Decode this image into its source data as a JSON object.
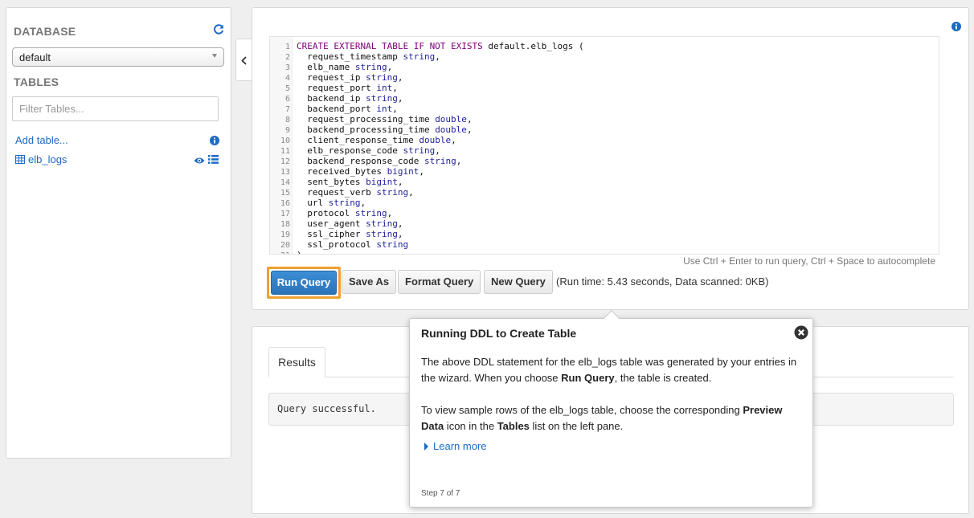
{
  "sidebar": {
    "database_heading": "DATABASE",
    "database_selected": "default",
    "tables_heading": "TABLES",
    "filter_placeholder": "Filter Tables...",
    "add_table": "Add table...",
    "tables": [
      {
        "name": "elb_logs"
      }
    ]
  },
  "editor": {
    "lines": [
      {
        "n": "1",
        "parts": [
          {
            "t": "CREATE EXTERNAL TABLE IF NOT EXISTS",
            "c": "kw"
          },
          {
            "t": " default.elb_logs (",
            "c": ""
          }
        ]
      },
      {
        "n": "2",
        "parts": [
          {
            "t": "  request_timestamp ",
            "c": ""
          },
          {
            "t": "string",
            "c": "ty"
          },
          {
            "t": ",",
            "c": ""
          }
        ]
      },
      {
        "n": "3",
        "parts": [
          {
            "t": "  elb_name ",
            "c": ""
          },
          {
            "t": "string",
            "c": "ty"
          },
          {
            "t": ",",
            "c": ""
          }
        ]
      },
      {
        "n": "4",
        "parts": [
          {
            "t": "  request_ip ",
            "c": ""
          },
          {
            "t": "string",
            "c": "ty"
          },
          {
            "t": ",",
            "c": ""
          }
        ]
      },
      {
        "n": "5",
        "parts": [
          {
            "t": "  request_port ",
            "c": ""
          },
          {
            "t": "int",
            "c": "ty"
          },
          {
            "t": ",",
            "c": ""
          }
        ]
      },
      {
        "n": "6",
        "parts": [
          {
            "t": "  backend_ip ",
            "c": ""
          },
          {
            "t": "string",
            "c": "ty"
          },
          {
            "t": ",",
            "c": ""
          }
        ]
      },
      {
        "n": "7",
        "parts": [
          {
            "t": "  backend_port ",
            "c": ""
          },
          {
            "t": "int",
            "c": "ty"
          },
          {
            "t": ",",
            "c": ""
          }
        ]
      },
      {
        "n": "8",
        "parts": [
          {
            "t": "  request_processing_time ",
            "c": ""
          },
          {
            "t": "double",
            "c": "ty"
          },
          {
            "t": ",",
            "c": ""
          }
        ]
      },
      {
        "n": "9",
        "parts": [
          {
            "t": "  backend_processing_time ",
            "c": ""
          },
          {
            "t": "double",
            "c": "ty"
          },
          {
            "t": ",",
            "c": ""
          }
        ]
      },
      {
        "n": "10",
        "parts": [
          {
            "t": "  client_response_time ",
            "c": ""
          },
          {
            "t": "double",
            "c": "ty"
          },
          {
            "t": ",",
            "c": ""
          }
        ]
      },
      {
        "n": "11",
        "parts": [
          {
            "t": "  elb_response_code ",
            "c": ""
          },
          {
            "t": "string",
            "c": "ty"
          },
          {
            "t": ",",
            "c": ""
          }
        ]
      },
      {
        "n": "12",
        "parts": [
          {
            "t": "  backend_response_code ",
            "c": ""
          },
          {
            "t": "string",
            "c": "ty"
          },
          {
            "t": ",",
            "c": ""
          }
        ]
      },
      {
        "n": "13",
        "parts": [
          {
            "t": "  received_bytes ",
            "c": ""
          },
          {
            "t": "bigint",
            "c": "ty"
          },
          {
            "t": ",",
            "c": ""
          }
        ]
      },
      {
        "n": "14",
        "parts": [
          {
            "t": "  sent_bytes ",
            "c": ""
          },
          {
            "t": "bigint",
            "c": "ty"
          },
          {
            "t": ",",
            "c": ""
          }
        ]
      },
      {
        "n": "15",
        "parts": [
          {
            "t": "  request_verb ",
            "c": ""
          },
          {
            "t": "string",
            "c": "ty"
          },
          {
            "t": ",",
            "c": ""
          }
        ]
      },
      {
        "n": "16",
        "parts": [
          {
            "t": "  url ",
            "c": ""
          },
          {
            "t": "string",
            "c": "ty"
          },
          {
            "t": ",",
            "c": ""
          }
        ]
      },
      {
        "n": "17",
        "parts": [
          {
            "t": "  protocol ",
            "c": ""
          },
          {
            "t": "string",
            "c": "ty"
          },
          {
            "t": ",",
            "c": ""
          }
        ]
      },
      {
        "n": "18",
        "parts": [
          {
            "t": "  user_agent ",
            "c": ""
          },
          {
            "t": "string",
            "c": "ty"
          },
          {
            "t": ",",
            "c": ""
          }
        ]
      },
      {
        "n": "19",
        "parts": [
          {
            "t": "  ssl_cipher ",
            "c": ""
          },
          {
            "t": "string",
            "c": "ty"
          },
          {
            "t": ",",
            "c": ""
          }
        ]
      },
      {
        "n": "20",
        "parts": [
          {
            "t": "  ssl_protocol ",
            "c": ""
          },
          {
            "t": "string",
            "c": "ty"
          }
        ]
      },
      {
        "n": "21",
        "parts": [
          {
            "t": ")",
            "c": ""
          }
        ]
      }
    ],
    "hint": "Use Ctrl + Enter to run query, Ctrl + Space to autocomplete"
  },
  "toolbar": {
    "run_query": "Run Query",
    "save_as": "Save As",
    "format_query": "Format Query",
    "new_query": "New Query",
    "run_status": "(Run time: 5.43 seconds, Data scanned: 0KB)"
  },
  "results": {
    "tab_label": "Results",
    "message": "Query successful."
  },
  "popover": {
    "title": "Running DDL to Create Table",
    "p1_a": "The above DDL statement for the elb_logs table was generated by your entries in the wizard. When you choose ",
    "p1_b": "Run Query",
    "p1_c": ", the table is created.",
    "p2_a": "To view sample rows of the elb_logs table, choose the corresponding ",
    "p2_b": "Preview Data",
    "p2_c": " icon in the ",
    "p2_d": "Tables",
    "p2_e": " list on the left pane.",
    "learn_more": "Learn more",
    "step": "Step 7 of 7"
  },
  "colors": {
    "accent": "#1b6ac6",
    "run_button": "#2b73b8",
    "highlight": "#f0a032"
  },
  "icons": [
    "refresh-icon",
    "info-icon",
    "table-icon",
    "eye-icon",
    "list-icon",
    "chevron-left-icon",
    "close-icon"
  ]
}
